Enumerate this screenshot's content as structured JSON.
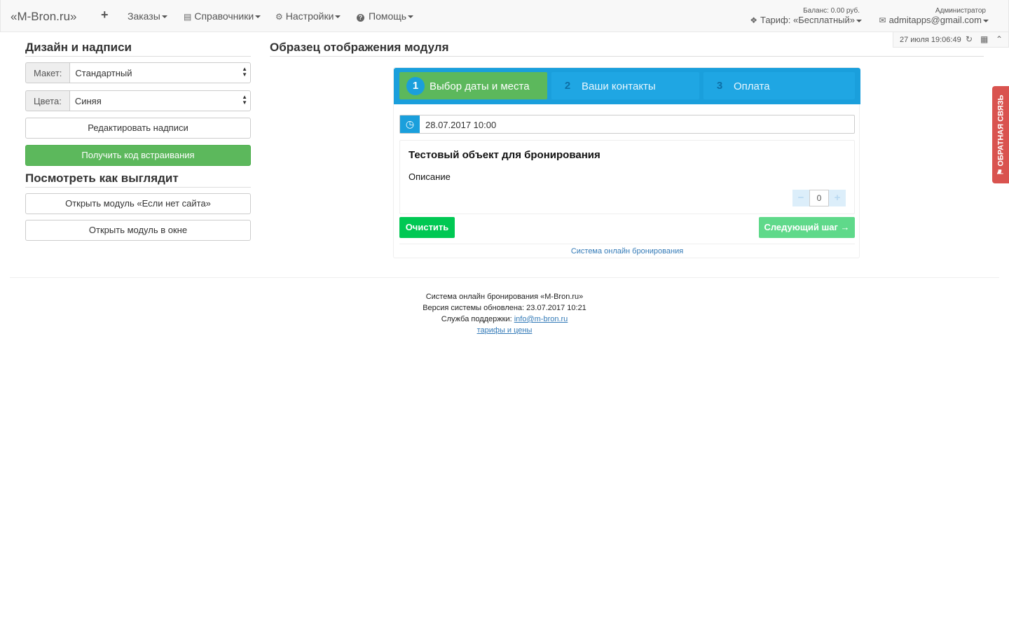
{
  "navbar": {
    "brand": "«M-Bron.ru»",
    "plus_icon": "plus-icon",
    "menu": [
      {
        "label": "Заказы",
        "icon": ""
      },
      {
        "label": "Справочники",
        "icon": "list-icon"
      },
      {
        "label": "Настройки",
        "icon": "gear-icon"
      },
      {
        "label": "Помощь",
        "icon": "help-icon"
      }
    ],
    "balance": "Баланс: 0.00 руб.",
    "tariff": "Тариф: «Бесплатный»",
    "role": "Администратор",
    "user_email": "admitapps@gmail.com"
  },
  "datebar": {
    "datetime": "27 июля 19:06:49"
  },
  "left": {
    "design_title": "Дизайн и надписи",
    "layout_label": "Макет:",
    "layout_value": "Стандартный",
    "colors_label": "Цвета:",
    "colors_value": "Синяя",
    "edit_labels_button": "Редактировать надписи",
    "get_code_button": "Получить код встраивания",
    "preview_title": "Посмотреть как выглядит",
    "open_no_site_button": "Открыть модуль «Если нет сайта»",
    "open_window_button": "Открыть модуль в окне"
  },
  "sample": {
    "title": "Образец отображения модуля",
    "steps": [
      {
        "num": "1",
        "label": "Выбор даты и места"
      },
      {
        "num": "2",
        "label": "Ваши контакты"
      },
      {
        "num": "3",
        "label": "Оплата"
      }
    ],
    "date_value": "28.07.2017 10:00",
    "object_title": "Тестовый объект для бронирования",
    "object_desc": "Описание",
    "quantity": "0",
    "clear_button": "Очистить",
    "next_button": "Следующий шаг →",
    "footer_link": "Система онлайн бронирования"
  },
  "feedback": {
    "label": "ОБРАТНАЯ СВЯЗЬ"
  },
  "footer": {
    "line1": "Система онлайн бронирования «M-Bron.ru»",
    "line2": "Версия системы обновлена: 23.07.2017 10:21",
    "support_label": "Служба поддержки:",
    "support_email": "info@m-bron.ru",
    "tariffs_link": "тарифы и цены"
  },
  "colors": {
    "accent_blue": "#1a9fdc",
    "success_green": "#5cb85c",
    "clear_green": "#00c853",
    "feedback_red": "#d9534f"
  }
}
